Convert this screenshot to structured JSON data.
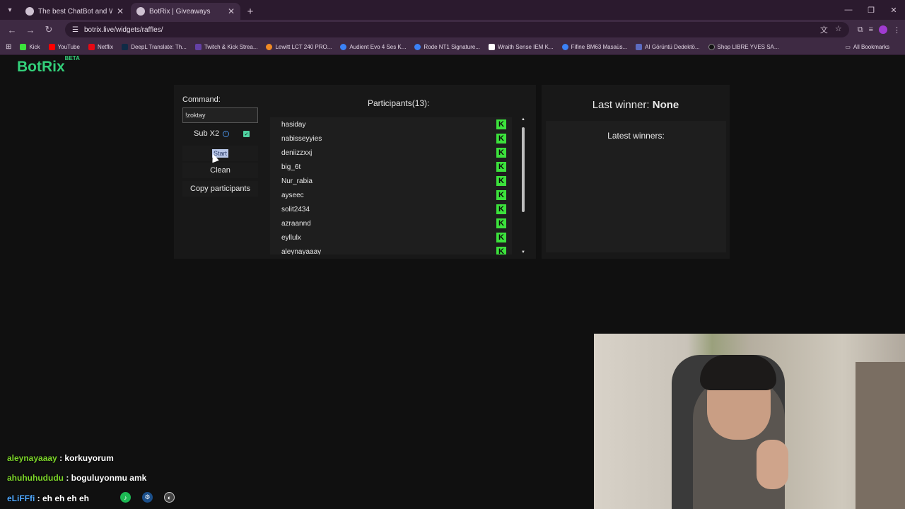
{
  "browser": {
    "tabs": [
      {
        "title": "The best ChatBot and Widgets",
        "active": false
      },
      {
        "title": "BotRix | Giveaways",
        "active": true
      }
    ],
    "url": "botrix.live/widgets/raffles/",
    "bookmarks": [
      {
        "label": "Kick",
        "color": "#3ce23c"
      },
      {
        "label": "YouTube",
        "color": "#ff0000"
      },
      {
        "label": "Netflix",
        "color": "#e50914"
      },
      {
        "label": "DeepL Translate: Th...",
        "color": "#0f2b46"
      },
      {
        "label": "Twitch & Kick Strea...",
        "color": "#6441a5"
      },
      {
        "label": "Lewitt LCT 240 PRO...",
        "color": "#f08a24"
      },
      {
        "label": "Audient Evo 4 Ses K...",
        "color": "#3b82f6"
      },
      {
        "label": "Rode NT1 Signature...",
        "color": "#3b82f6"
      },
      {
        "label": "Wraith Sense IEM K...",
        "color": "#ffffff"
      },
      {
        "label": "Fifine BM63 Masaüs...",
        "color": "#3b82f6"
      },
      {
        "label": "AI Görüntü Dedektö...",
        "color": "#5c6bc0"
      },
      {
        "label": "Shop LIBRE YVES SA...",
        "color": "#111111"
      }
    ],
    "all_bookmarks": "All Bookmarks"
  },
  "app": {
    "logo": "BotRix",
    "logo_badge": "BETA",
    "command_label": "Command:",
    "command_value": "!zoktay",
    "sub_label": "Sub X2",
    "sub_checked": true,
    "start_label": "Start",
    "clean_label": "Clean",
    "copy_label": "Copy participants",
    "participants_title": "Participants(13):",
    "participants": [
      "hasiday",
      "nabisseyyies",
      "deniizzxxj",
      "big_6t",
      "Nur_rabia",
      "ayseec",
      "solit2434",
      "azraannd",
      "eyllulx",
      "aleynayaaay"
    ],
    "platform_badge": "K",
    "last_winner_label": "Last winner: ",
    "last_winner_value": "None",
    "latest_winners_label": "Latest winners:"
  },
  "chat": [
    {
      "user": "aleynayaaay",
      "message": " : korkuyorum"
    },
    {
      "user": "ahuhuhududu",
      "message": " : boguluyonmu amk"
    },
    {
      "user": "eLiFFfi",
      "message": " : eh eh eh eh"
    }
  ]
}
